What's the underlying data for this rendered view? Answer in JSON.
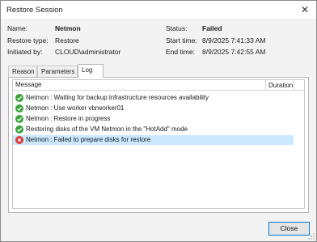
{
  "window": {
    "title": "Restore Session",
    "close_glyph": "✕"
  },
  "info": {
    "name_label": "Name:",
    "name_value": "Netmon",
    "restore_type_label": "Restore type:",
    "restore_type_value": "Restore",
    "initiated_label": "Initiated by:",
    "initiated_value": "CLOUD\\administrator",
    "status_label": "Status:",
    "status_value": "Failed",
    "start_label": "Start time:",
    "start_value": "8/9/2025 7:41:33 AM",
    "end_label": "End time:",
    "end_value": "8/9/2025 7:42:55 AM"
  },
  "tabs": [
    {
      "label": "Reason",
      "active": false
    },
    {
      "label": "Parameters",
      "active": false
    },
    {
      "label": "Log",
      "active": true
    }
  ],
  "log": {
    "columns": {
      "message": "Message",
      "duration": "Duration"
    },
    "rows": [
      {
        "icon": "success-check-icon",
        "status": "success",
        "message": "Netmon : Waiting for backup infrastructure resources availability",
        "duration": ""
      },
      {
        "icon": "success-check-icon",
        "status": "success",
        "message": "Netmon : Use worker vbrworker01",
        "duration": ""
      },
      {
        "icon": "success-check-icon",
        "status": "success",
        "message": "Netmon : Restore in progress",
        "duration": ""
      },
      {
        "icon": "success-check-icon",
        "status": "success",
        "message": "Restoring disks of the VM Netmon in the \"HotAdd\" mode",
        "duration": ""
      },
      {
        "icon": "error-x-icon",
        "status": "error",
        "message": "Netmon : Failed to prepare disks for restore",
        "duration": "",
        "selected": true
      }
    ]
  },
  "buttons": {
    "close_label": "Close"
  },
  "colors": {
    "success": "#3aa33a",
    "error": "#d93a3a",
    "selection": "#cce8ff",
    "focus_border": "#0078d7"
  }
}
